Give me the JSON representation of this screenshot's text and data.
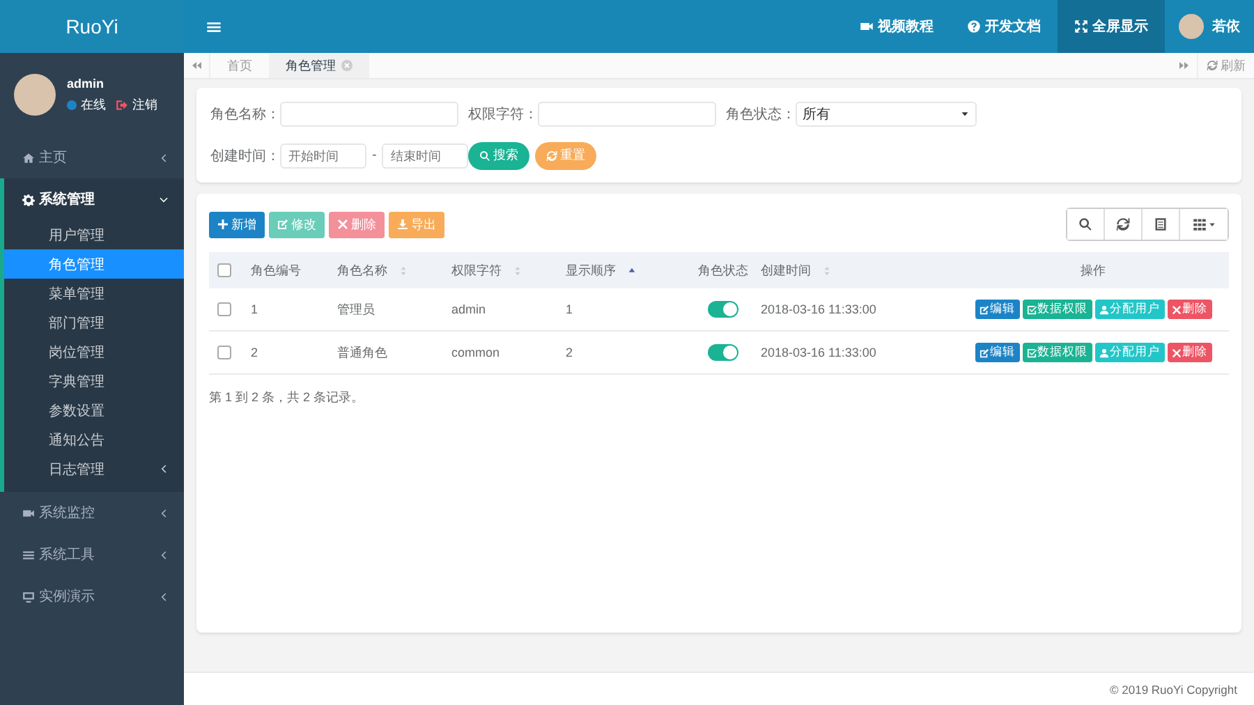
{
  "topbar": {
    "logo": "RuoYi",
    "links": [
      {
        "label": "视频教程",
        "selected": false
      },
      {
        "label": "开发文档",
        "selected": false
      },
      {
        "label": "全屏显示",
        "selected": true
      }
    ],
    "user": "若依"
  },
  "sidebar": {
    "user": {
      "name": "admin",
      "status": "在线",
      "logout": "注销"
    },
    "items": [
      {
        "label": "主页",
        "expanded": false
      },
      {
        "label": "系统管理",
        "expanded": true,
        "children": [
          {
            "label": "用户管理",
            "selected": false,
            "expandable": false
          },
          {
            "label": "角色管理",
            "selected": true,
            "expandable": false
          },
          {
            "label": "菜单管理",
            "selected": false,
            "expandable": false
          },
          {
            "label": "部门管理",
            "selected": false,
            "expandable": false
          },
          {
            "label": "岗位管理",
            "selected": false,
            "expandable": false
          },
          {
            "label": "字典管理",
            "selected": false,
            "expandable": false
          },
          {
            "label": "参数设置",
            "selected": false,
            "expandable": false
          },
          {
            "label": "通知公告",
            "selected": false,
            "expandable": false
          },
          {
            "label": "日志管理",
            "selected": false,
            "expandable": true
          }
        ]
      },
      {
        "label": "系统监控",
        "expanded": false
      },
      {
        "label": "系统工具",
        "expanded": false
      },
      {
        "label": "实例演示",
        "expanded": false
      }
    ]
  },
  "tabs": [
    {
      "label": "首页",
      "selected": false,
      "closable": false
    },
    {
      "label": "角色管理",
      "selected": true,
      "closable": true
    }
  ],
  "refresh": "刷新",
  "search_form": {
    "fields": [
      {
        "label": "角色名称：",
        "kind": "text"
      },
      {
        "label": "权限字符：",
        "kind": "text"
      },
      {
        "label": "角色状态：",
        "kind": "select",
        "value": "所有"
      },
      {
        "label": "创建时间：",
        "kind": "range",
        "start_placeholder": "开始时间",
        "separator": "-",
        "end_placeholder": "结束时间"
      }
    ],
    "buttons": [
      {
        "label": "搜索",
        "kind": "search"
      },
      {
        "label": "重置",
        "kind": "reset"
      }
    ]
  },
  "toolbar": [
    {
      "label": "新增",
      "kind": "add",
      "disabled": false
    },
    {
      "label": "修改",
      "kind": "edit",
      "disabled": true
    },
    {
      "label": "删除",
      "kind": "delete",
      "disabled": true
    },
    {
      "label": "导出",
      "kind": "export",
      "disabled": false
    }
  ],
  "table": {
    "select_all_checked": false,
    "columns": [
      {
        "label": "角色编号",
        "sortable": false,
        "sorted": false
      },
      {
        "label": "角色名称",
        "sortable": true,
        "sorted": false
      },
      {
        "label": "权限字符",
        "sortable": true,
        "sorted": false
      },
      {
        "label": "显示顺序",
        "sortable": true,
        "sorted": true
      },
      {
        "label": "角色状态",
        "sortable": false,
        "sorted": false
      },
      {
        "label": "创建时间",
        "sortable": true,
        "sorted": false
      },
      {
        "label": "操作",
        "sortable": false,
        "sorted": false
      }
    ],
    "rows": [
      {
        "checked": false,
        "id": "1",
        "name": "管理员",
        "key": "admin",
        "order": "1",
        "status_on": true,
        "created": "2018-03-16 11:33:00",
        "actions": [
          {
            "label": "编辑",
            "kind": "edit"
          },
          {
            "label": "数据权限",
            "kind": "data"
          },
          {
            "label": "分配用户",
            "kind": "user"
          },
          {
            "label": "删除",
            "kind": "delete"
          }
        ]
      },
      {
        "checked": false,
        "id": "2",
        "name": "普通角色",
        "key": "common",
        "order": "2",
        "status_on": true,
        "created": "2018-03-16 11:33:00",
        "actions": [
          {
            "label": "编辑",
            "kind": "edit"
          },
          {
            "label": "数据权限",
            "kind": "data"
          },
          {
            "label": "分配用户",
            "kind": "user"
          },
          {
            "label": "删除",
            "kind": "delete"
          }
        ]
      }
    ]
  },
  "pagination": "第 1 到 2 条，共 2 条记录。",
  "footer": "© 2019 RuoYi Copyright"
}
